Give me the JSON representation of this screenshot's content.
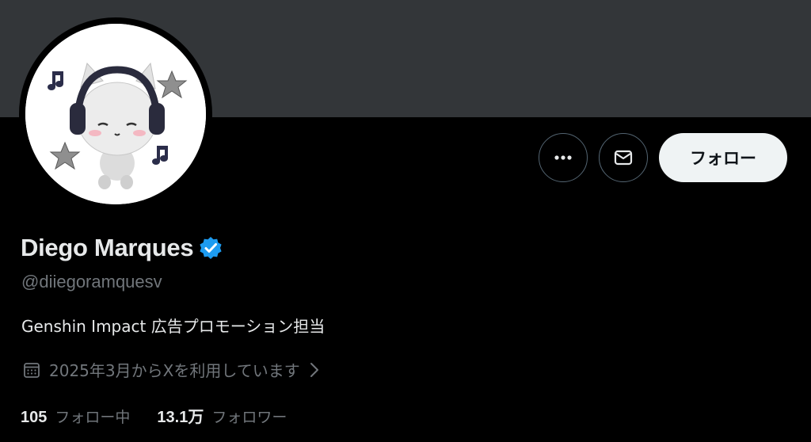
{
  "profile": {
    "display_name": "Diego Marques",
    "handle": "@diiegoramquesv",
    "bio": "Genshin Impact 広告プロモーション担当",
    "joined": "2025年3月からXを利用しています",
    "verified": true
  },
  "actions": {
    "follow_label": "フォロー",
    "more_icon": "more-icon",
    "message_icon": "envelope-icon"
  },
  "stats": {
    "following_count": "105",
    "following_label": "フォロー中",
    "followers_count": "13.1万",
    "followers_label": "フォロワー"
  },
  "colors": {
    "banner": "#333639",
    "background": "#000000",
    "verified": "#1d9bf0",
    "muted_text": "#71767b"
  }
}
